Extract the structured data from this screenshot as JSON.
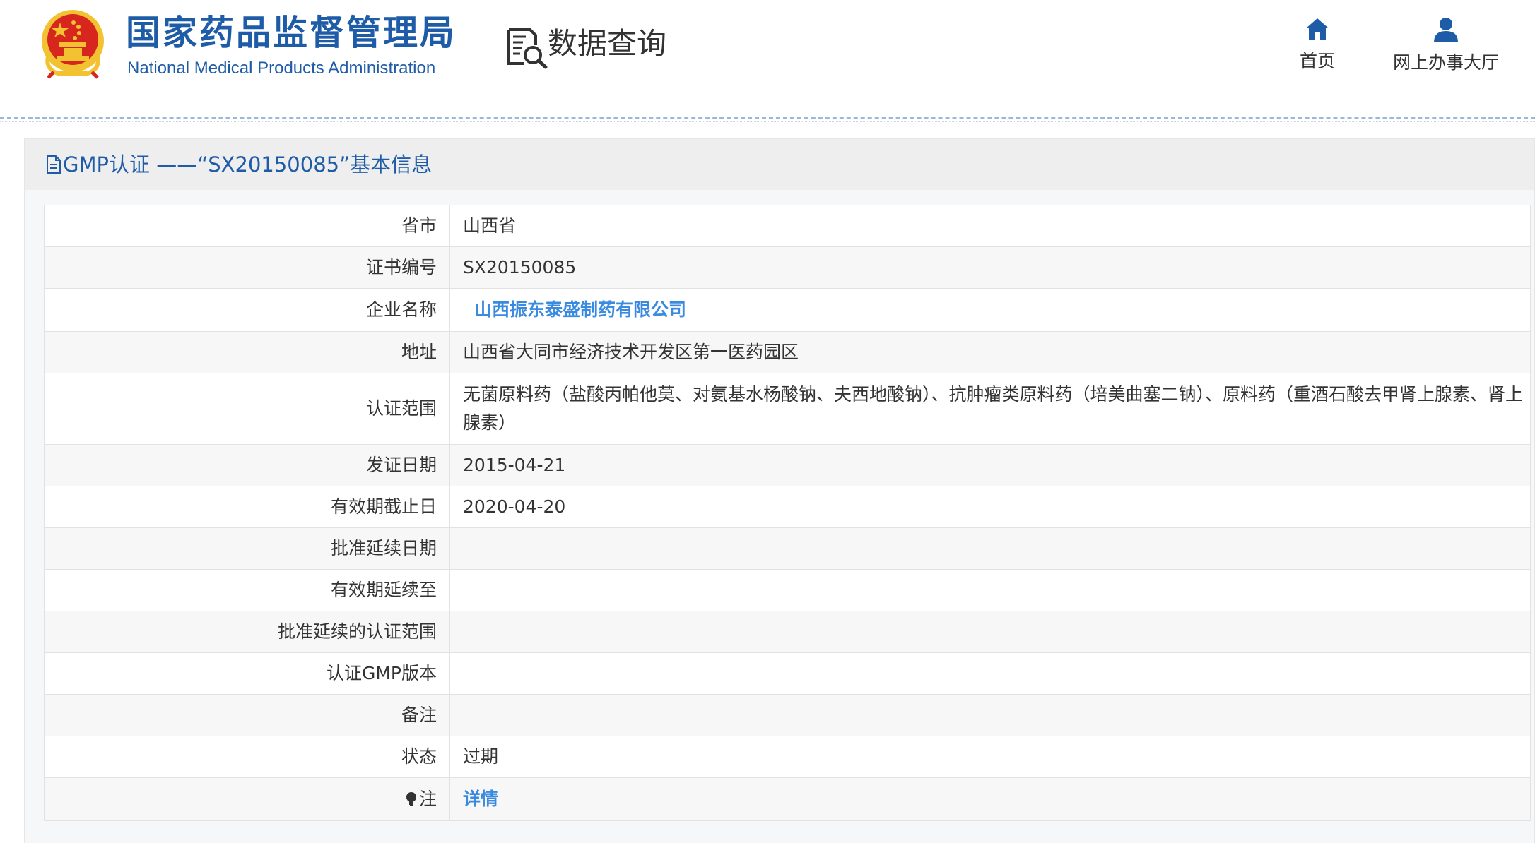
{
  "colors": {
    "brand_blue": "#1f5ca8",
    "link_blue": "#3a8be0",
    "emblem_red": "#d7261d",
    "emblem_gold": "#f2c230"
  },
  "header": {
    "title_cn": "国家药品监督管理局",
    "title_en": "National Medical Products Administration",
    "section_title": "数据查询",
    "emblem_icon": "national-emblem-icon",
    "search_icon": "data-query-icon",
    "nav": [
      {
        "label": "首页",
        "icon": "home-icon"
      },
      {
        "label": "网上办事大厅",
        "icon": "user-icon"
      }
    ]
  },
  "panel": {
    "title": "GMP认证 ——“SX20150085”基本信息",
    "title_icon": "document-icon"
  },
  "details": [
    {
      "label": "省市",
      "value": "山西省"
    },
    {
      "label": "证书编号",
      "value": "SX20150085"
    },
    {
      "label": "企业名称",
      "value": "山西振东泰盛制药有限公司"
    },
    {
      "label": "地址",
      "value": "山西省大同市经济技术开发区第一医药园区"
    },
    {
      "label": "认证范围",
      "value": "无菌原料药（盐酸丙帕他莫、对氨基水杨酸钠、夫西地酸钠）、抗肿瘤类原料药（培美曲塞二钠）、原料药（重酒石酸去甲肾上腺素、肾上腺素）"
    },
    {
      "label": "发证日期",
      "value": "2015-04-21"
    },
    {
      "label": "有效期截止日",
      "value": "2020-04-20"
    },
    {
      "label": "批准延续日期",
      "value": ""
    },
    {
      "label": "有效期延续至",
      "value": ""
    },
    {
      "label": "批准延续的认证范围",
      "value": ""
    },
    {
      "label": "认证GMP版本",
      "value": ""
    },
    {
      "label": "备注",
      "value": ""
    },
    {
      "label": "状态",
      "value": "过期"
    },
    {
      "label": "注",
      "value": "详情",
      "icon": "lightbulb-icon"
    }
  ]
}
